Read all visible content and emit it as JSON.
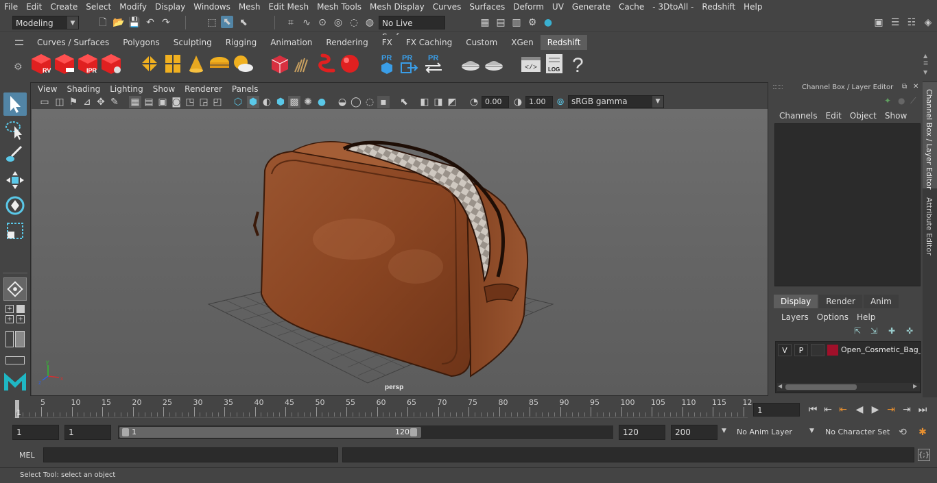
{
  "menubar": [
    "File",
    "Edit",
    "Create",
    "Select",
    "Modify",
    "Display",
    "Windows",
    "Mesh",
    "Edit Mesh",
    "Mesh Tools",
    "Mesh Display",
    "Curves",
    "Surfaces",
    "Deform",
    "UV",
    "Generate",
    "Cache",
    "- 3DtoAll -",
    "Redshift",
    "Help"
  ],
  "statusline": {
    "mode": "Modeling",
    "live_surface": "No Live Surface"
  },
  "shelf_tabs": [
    "Curves / Surfaces",
    "Polygons",
    "Sculpting",
    "Rigging",
    "Animation",
    "Rendering",
    "FX",
    "FX Caching",
    "Custom",
    "XGen",
    "Redshift"
  ],
  "shelf_active": "Redshift",
  "shelf_labels": {
    "rv": "RV",
    "ipr": "IPR",
    "pr": "PR",
    "log": "LOG",
    "help": "?"
  },
  "viewport": {
    "menu": [
      "View",
      "Shading",
      "Lighting",
      "Show",
      "Renderer",
      "Panels"
    ],
    "exposure": "0.00",
    "gamma": "1.00",
    "colorspace": "sRGB gamma",
    "camera": "persp"
  },
  "channel_box": {
    "title": "Channel Box / Layer Editor",
    "menu": [
      "Channels",
      "Edit",
      "Object",
      "Show"
    ],
    "layer_tabs": [
      "Display",
      "Render",
      "Anim"
    ],
    "layer_tab_active": "Display",
    "layer_menu": [
      "Layers",
      "Options",
      "Help"
    ],
    "layer": {
      "v": "V",
      "p": "P",
      "name": "Open_Cosmetic_Bag_L",
      "color": "#a0102a"
    }
  },
  "side_tabs": [
    "Channel Box / Layer Editor",
    "Attribute Editor"
  ],
  "timeline": {
    "ticks": [
      "5",
      "10",
      "15",
      "20",
      "25",
      "30",
      "35",
      "40",
      "45",
      "50",
      "55",
      "60",
      "65",
      "70",
      "75",
      "80",
      "85",
      "90",
      "95",
      "100",
      "105",
      "110",
      "115",
      "12"
    ],
    "current_frame_marker": "1",
    "current_frame": "1"
  },
  "range": {
    "start": "1",
    "playback_start": "1",
    "slider_start": "1",
    "slider_end": "120",
    "playback_end": "120",
    "end": "200",
    "anim_layer": "No Anim Layer",
    "character_set": "No Character Set"
  },
  "cmdline": {
    "lang": "MEL"
  },
  "helpline": "Select Tool: select an object",
  "colors": {
    "accent": "#5d5d5d",
    "redshift": "#e02020",
    "maya_teal": "#1fb7c4",
    "leather": "#8a4522",
    "selected_tool": "#5285a6"
  }
}
